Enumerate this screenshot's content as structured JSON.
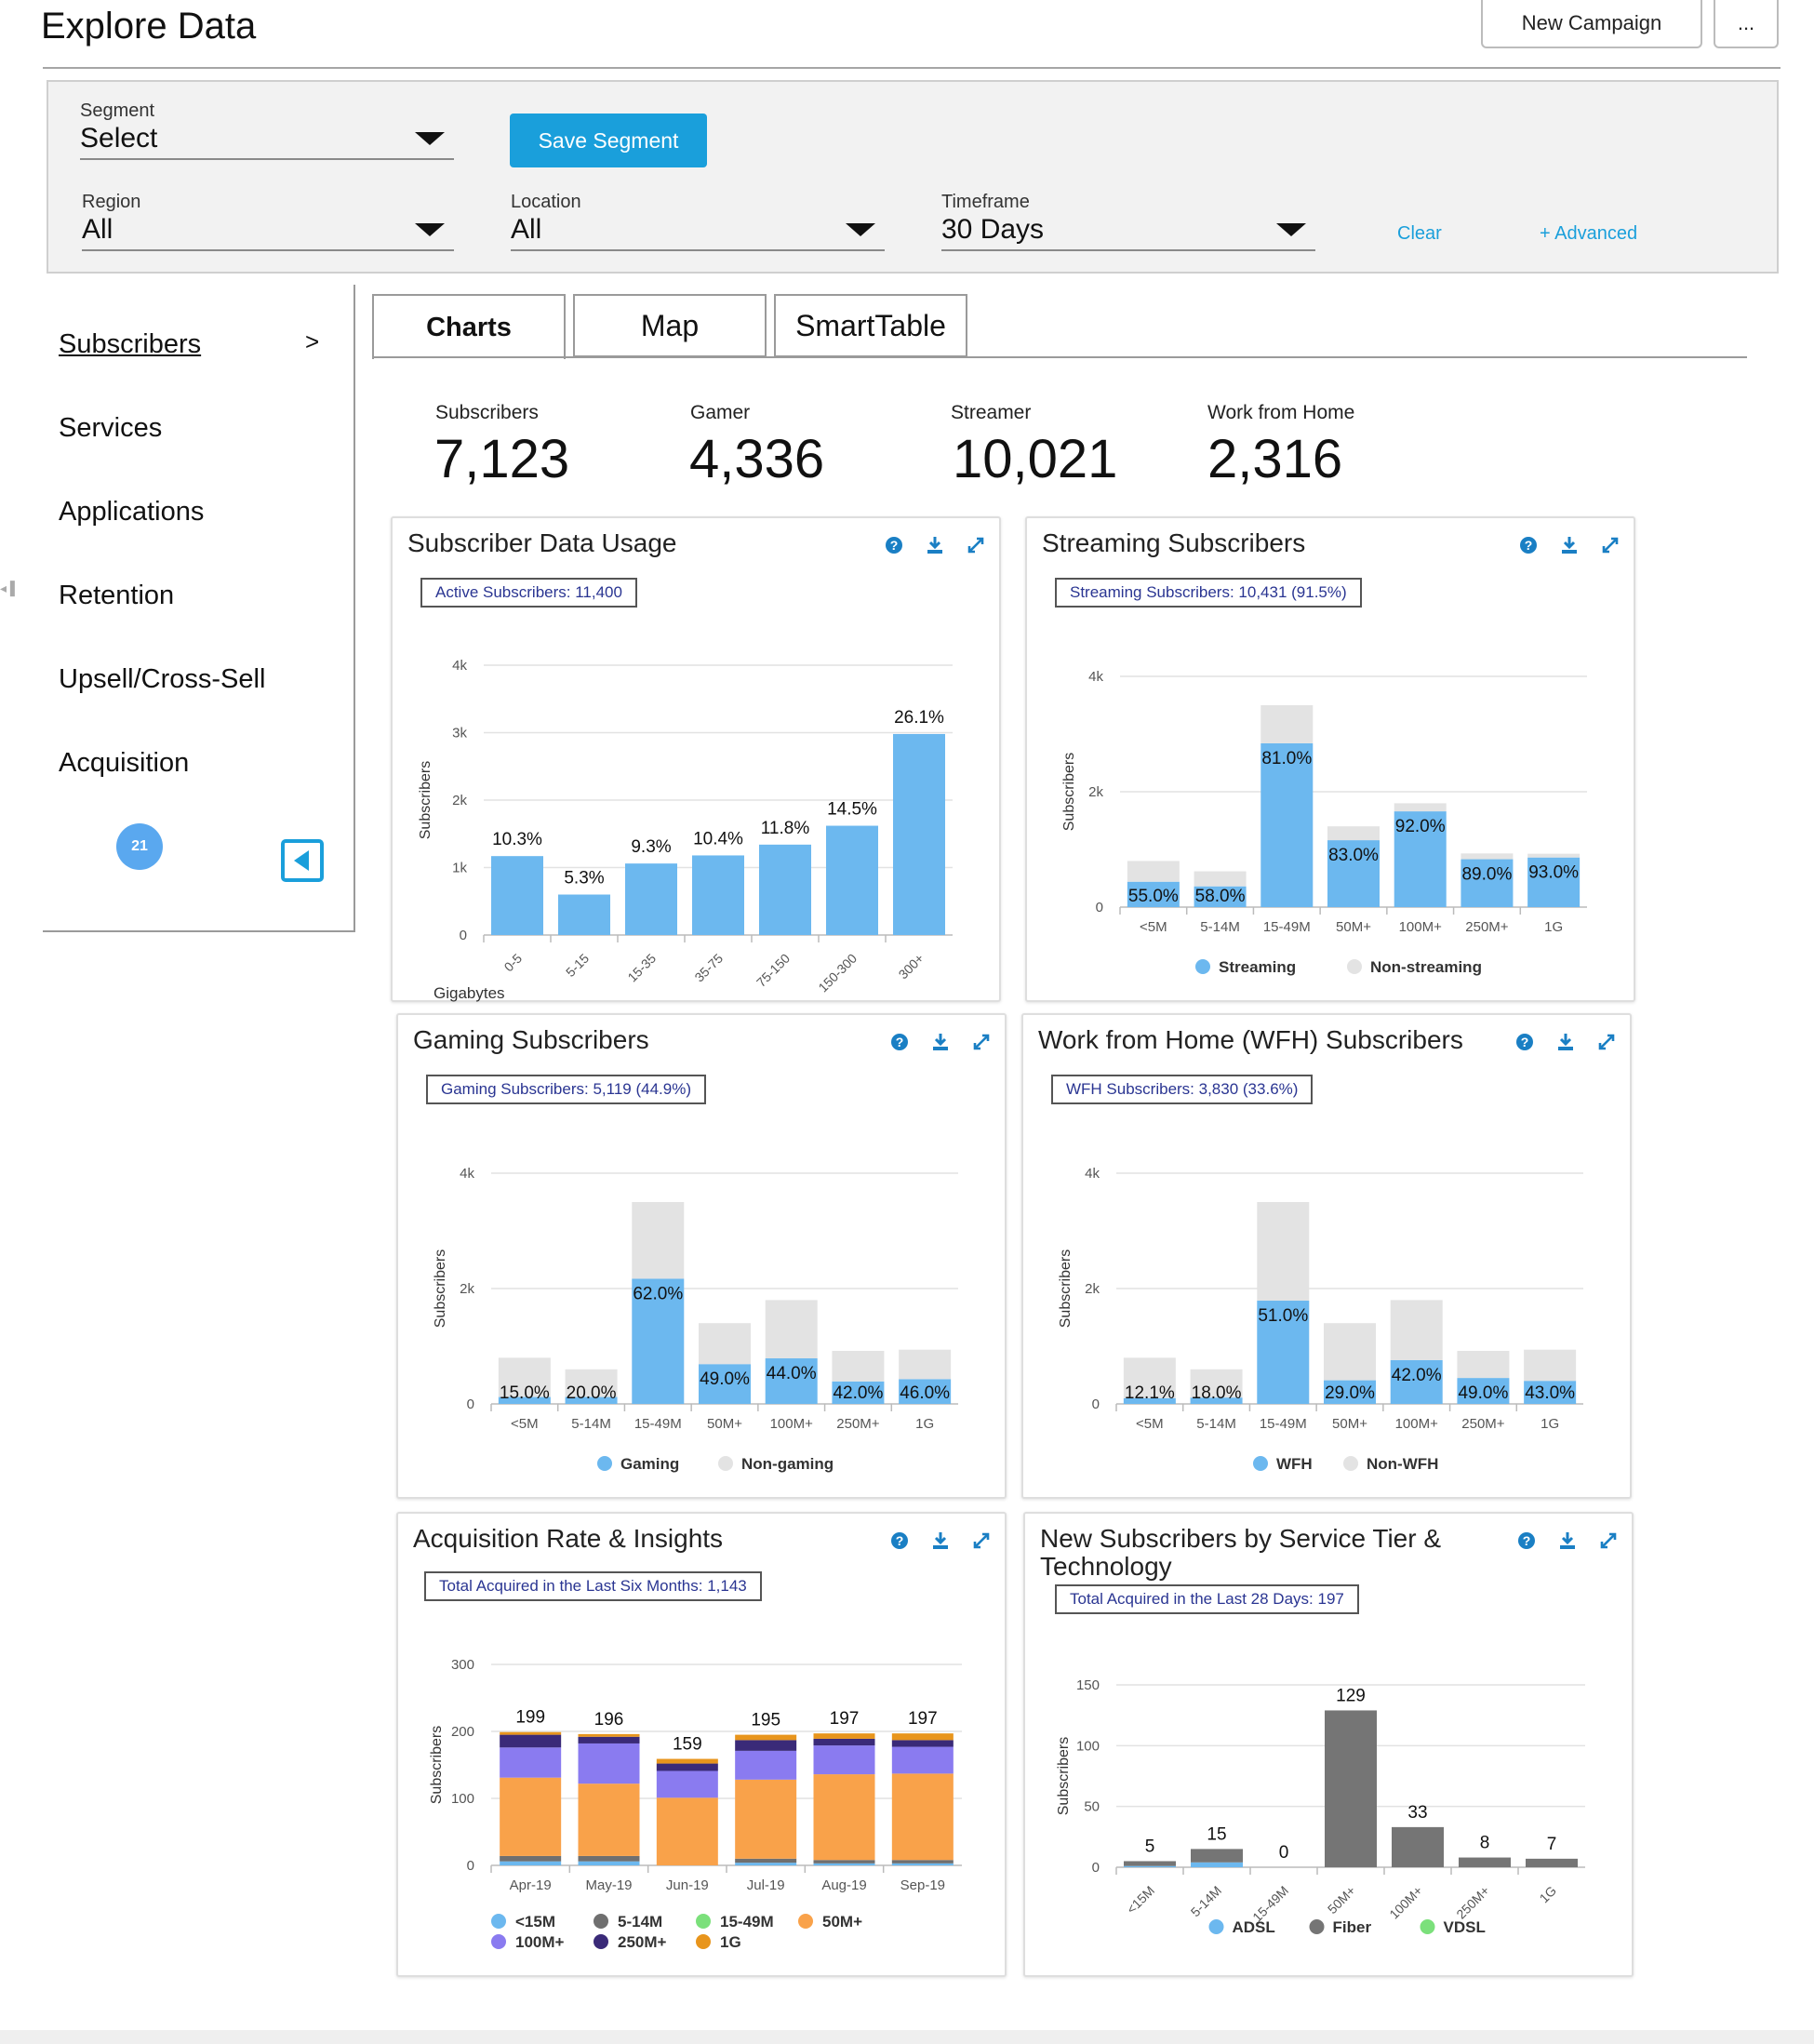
{
  "header": {
    "title": "Explore Data",
    "new_campaign_label": "New Campaign",
    "more_label": "..."
  },
  "filters": {
    "segment": {
      "label": "Segment",
      "value": "Select"
    },
    "save_segment_label": "Save Segment",
    "region": {
      "label": "Region",
      "value": "All"
    },
    "location": {
      "label": "Location",
      "value": "All"
    },
    "timeframe": {
      "label": "Timeframe",
      "value": "30 Days"
    },
    "clear_label": "Clear",
    "advanced_label": "+ Advanced"
  },
  "sidebar": {
    "items": [
      {
        "label": "Subscribers",
        "active": true
      },
      {
        "label": "Services"
      },
      {
        "label": "Applications"
      },
      {
        "label": "Retention"
      },
      {
        "label": "Upsell/Cross-Sell"
      },
      {
        "label": "Acquisition"
      }
    ],
    "active_arrow": ">",
    "badge_count": "21"
  },
  "tabs": [
    {
      "label": "Charts",
      "active": true
    },
    {
      "label": "Map"
    },
    {
      "label": "SmartTable"
    }
  ],
  "kpis": [
    {
      "label": "Subscribers",
      "value": "7,123"
    },
    {
      "label": "Gamer",
      "value": "4,336"
    },
    {
      "label": "Streamer",
      "value": "10,021"
    },
    {
      "label": "Work from Home",
      "value": "2,316"
    }
  ],
  "colors": {
    "accent": "#1a9fdb",
    "bar_blue": "#6cb8ef",
    "bar_grey": "#e3e3e3",
    "summary_text": "#2a3592",
    "dark_bar": "#757575"
  },
  "cards": {
    "data_usage": {
      "title": "Subscriber Data Usage",
      "summary": "Active Subscribers: 11,400"
    },
    "streaming": {
      "title": "Streaming Subscribers",
      "summary": "Streaming Subscribers: 10,431 (91.5%)"
    },
    "gaming": {
      "title": "Gaming Subscribers",
      "summary": "Gaming Subscribers: 5,119 (44.9%)"
    },
    "wfh": {
      "title": "Work from Home (WFH) Subscribers",
      "summary": "WFH Subscribers: 3,830 (33.6%)"
    },
    "acquisition": {
      "title": "Acquisition Rate & Insights",
      "summary": "Total Acquired in the Last Six Months: 1,143"
    },
    "new_subs": {
      "title": "New Subscribers by Service Tier & Technology",
      "summary": "Total Acquired in the Last 28 Days: 197"
    }
  },
  "chart_data": [
    {
      "id": "data_usage",
      "type": "bar",
      "categories": [
        "0-5",
        "5-15",
        "15-35",
        "35-75",
        "75-150",
        "150-300",
        "300+"
      ],
      "values": [
        1170,
        600,
        1060,
        1180,
        1340,
        1620,
        2980
      ],
      "labels": [
        "10.3%",
        "5.3%",
        "9.3%",
        "10.4%",
        "11.8%",
        "14.5%",
        "26.1%"
      ],
      "xlabel": "Gigabytes",
      "ylabel": "Subscribers",
      "yticks": [
        "0",
        "1k",
        "2k",
        "3k",
        "4k"
      ],
      "ylim": [
        0,
        4000
      ]
    },
    {
      "id": "streaming",
      "type": "bar",
      "stacked": true,
      "categories": [
        "<5M",
        "5-14M",
        "15-49M",
        "50M+",
        "100M+",
        "250M+",
        "1G"
      ],
      "series": [
        {
          "name": "Streaming",
          "values": [
            440,
            360,
            2840,
            1160,
            1660,
            830,
            860
          ]
        },
        {
          "name": "Non-streaming",
          "values": [
            360,
            260,
            660,
            240,
            140,
            100,
            65
          ]
        }
      ],
      "labels": [
        "55.0%",
        "58.0%",
        "81.0%",
        "83.0%",
        "92.0%",
        "89.0%",
        "93.0%"
      ],
      "ylabel": "Subscribers",
      "yticks": [
        "0",
        "2k",
        "4k"
      ],
      "ylim": [
        0,
        4000
      ],
      "legend": "bottom"
    },
    {
      "id": "gaming",
      "type": "bar",
      "stacked": true,
      "categories": [
        "<5M",
        "5-14M",
        "15-49M",
        "50M+",
        "100M+",
        "250M+",
        "1G"
      ],
      "series": [
        {
          "name": "Gaming",
          "values": [
            120,
            120,
            2170,
            690,
            790,
            390,
            430
          ]
        },
        {
          "name": "Non-gaming",
          "values": [
            680,
            480,
            1330,
            710,
            1010,
            530,
            510
          ]
        }
      ],
      "labels": [
        "15.0%",
        "20.0%",
        "62.0%",
        "49.0%",
        "44.0%",
        "42.0%",
        "46.0%"
      ],
      "ylabel": "Subscribers",
      "yticks": [
        "0",
        "2k",
        "4k"
      ],
      "ylim": [
        0,
        4000
      ],
      "legend": "bottom"
    },
    {
      "id": "wfh",
      "type": "bar",
      "stacked": true,
      "categories": [
        "<5M",
        "5-14M",
        "15-49M",
        "50M+",
        "100M+",
        "250M+",
        "1G"
      ],
      "series": [
        {
          "name": "WFH",
          "values": [
            100,
            110,
            1790,
            410,
            760,
            450,
            400
          ]
        },
        {
          "name": "Non-WFH",
          "values": [
            700,
            490,
            1710,
            990,
            1040,
            470,
            540
          ]
        }
      ],
      "labels": [
        "12.1%",
        "18.0%",
        "51.0%",
        "29.0%",
        "42.0%",
        "49.0%",
        "43.0%"
      ],
      "ylabel": "Subscribers",
      "yticks": [
        "0",
        "2k",
        "4k"
      ],
      "ylim": [
        0,
        4000
      ],
      "legend": "bottom"
    },
    {
      "id": "acquisition",
      "type": "bar",
      "stacked": true,
      "categories": [
        "Apr-19",
        "May-19",
        "Jun-19",
        "Jul-19",
        "Aug-19",
        "Sep-19"
      ],
      "series": [
        {
          "name": "<15M",
          "values": [
            6,
            6,
            0,
            4,
            3,
            3
          ]
        },
        {
          "name": "5-14M",
          "values": [
            8,
            8,
            0,
            6,
            5,
            5
          ]
        },
        {
          "name": "15-49M",
          "values": [
            0,
            0,
            0,
            0,
            0,
            0
          ]
        },
        {
          "name": "50M+",
          "values": [
            117,
            108,
            101,
            118,
            128,
            129
          ]
        },
        {
          "name": "100M+",
          "values": [
            45,
            60,
            40,
            43,
            43,
            40
          ]
        },
        {
          "name": "250M+",
          "values": [
            19,
            10,
            11,
            16,
            10,
            10
          ]
        },
        {
          "name": "1G",
          "values": [
            4,
            4,
            7,
            8,
            8,
            10
          ]
        }
      ],
      "totals": [
        "199",
        "196",
        "159",
        "195",
        "197",
        "197"
      ],
      "ylabel": "Subscribers",
      "yticks": [
        "0",
        "100",
        "200",
        "300"
      ],
      "ylim": [
        0,
        300
      ],
      "legend": "bottom"
    },
    {
      "id": "new_subs",
      "type": "bar",
      "stacked": true,
      "categories": [
        "<15M",
        "5-14M",
        "15-49M",
        "50M+",
        "100M+",
        "250M+",
        "1G"
      ],
      "series": [
        {
          "name": "ADSL",
          "values": [
            1,
            4,
            0,
            0,
            0,
            0,
            0
          ]
        },
        {
          "name": "Fiber",
          "values": [
            4,
            11,
            0,
            129,
            33,
            8,
            7
          ]
        },
        {
          "name": "VDSL",
          "values": [
            0,
            0,
            0,
            0,
            0,
            0,
            0
          ]
        }
      ],
      "totals": [
        "5",
        "15",
        "0",
        "129",
        "33",
        "8",
        "7"
      ],
      "ylabel": "Subscribers",
      "yticks": [
        "0",
        "50",
        "100",
        "150"
      ],
      "ylim": [
        0,
        150
      ],
      "legend": "bottom"
    }
  ]
}
